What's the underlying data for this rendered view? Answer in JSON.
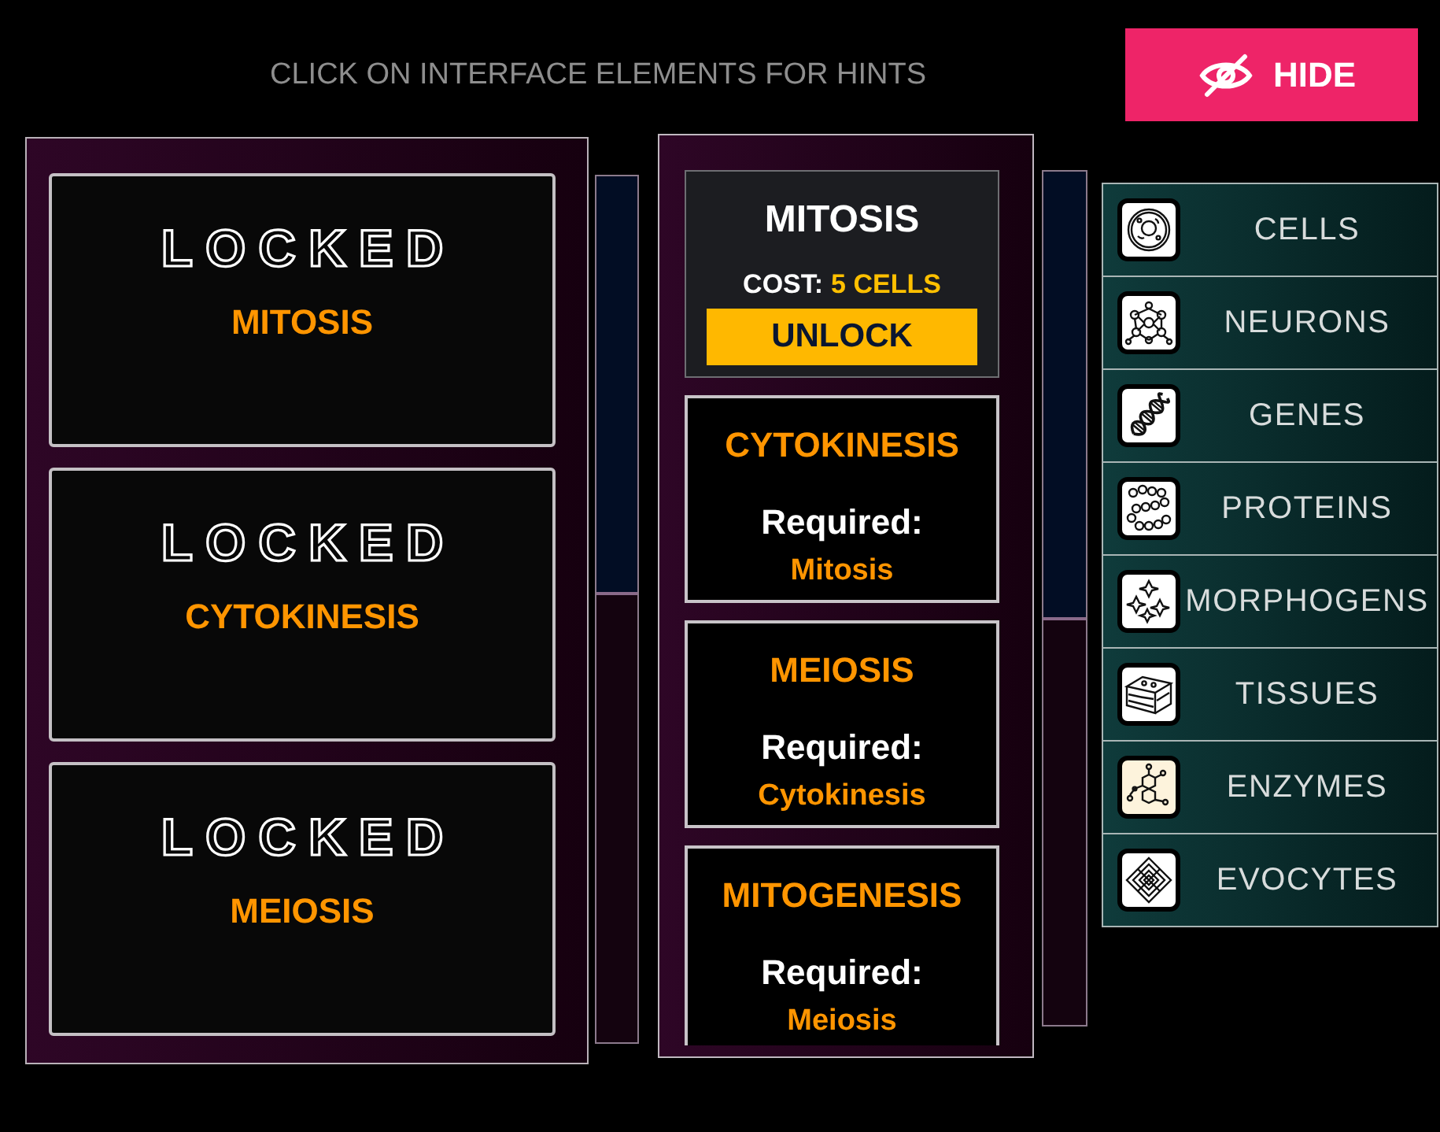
{
  "header": {
    "hint": "CLICK ON INTERFACE ELEMENTS FOR HINTS",
    "hide_button": {
      "label": "HIDE"
    }
  },
  "upgrades_panel": {
    "cards": [
      {
        "overlay": "LOCKED",
        "name": "MITOSIS"
      },
      {
        "overlay": "LOCKED",
        "name": "CYTOKINESIS"
      },
      {
        "overlay": "LOCKED",
        "name": "MEIOSIS"
      }
    ]
  },
  "unlocks_panel": {
    "cards": [
      {
        "kind": "available",
        "name": "MITOSIS",
        "cost_label": "COST:",
        "cost": "5 CELLS",
        "button": "UNLOCK"
      },
      {
        "kind": "required",
        "name": "CYTOKINESIS",
        "required_label": "Required:",
        "requirement": "Mitosis"
      },
      {
        "kind": "required",
        "name": "MEIOSIS",
        "required_label": "Required:",
        "requirement": "Cytokinesis"
      },
      {
        "kind": "required",
        "name": "MITOGENESIS",
        "required_label": "Required:",
        "requirement": "Meiosis"
      }
    ]
  },
  "categories": [
    {
      "label": "CELLS"
    },
    {
      "label": "NEURONS"
    },
    {
      "label": "GENES"
    },
    {
      "label": "PROTEINS"
    },
    {
      "label": "MORPHOGENS"
    },
    {
      "label": "TISSUES"
    },
    {
      "label": "ENZYMES"
    },
    {
      "label": "EVOCYTES"
    }
  ]
}
